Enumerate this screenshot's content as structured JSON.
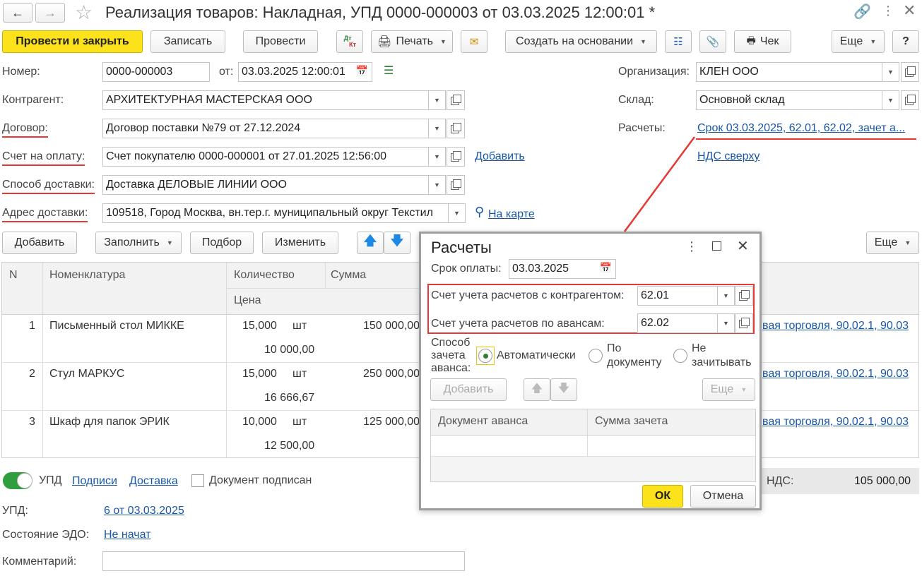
{
  "window": {
    "title": "Реализация товаров: Накладная, УПД 0000-000003 от 03.03.2025 12:00:01 *"
  },
  "toolbar": {
    "post_close": "Провести и закрыть",
    "save": "Записать",
    "post": "Провести",
    "dtkt_top": "Дт",
    "dtkt_bottom": "Кт",
    "print": "Печать",
    "create_based": "Создать на основании",
    "receipt": "Чек",
    "more": "Еще",
    "help": "?"
  },
  "form": {
    "number_label": "Номер:",
    "number_value": "0000-000003",
    "date_label": "от:",
    "date_value": "03.03.2025 12:00:01",
    "org_label": "Организация:",
    "org_value": "КЛЕН ООО",
    "counterparty_label": "Контрагент:",
    "counterparty_value": "АРХИТЕКТУРНАЯ МАСТЕРСКАЯ ООО",
    "warehouse_label": "Склад:",
    "warehouse_value": "Основной склад",
    "contract_label": "Договор:",
    "contract_value": "Договор поставки №79 от 27.12.2024",
    "settlements_label": "Расчеты:",
    "settlements_link": "Срок 03.03.2025, 62.01, 62.02, зачет а...",
    "invoice_label": "Счет на оплату:",
    "invoice_value": "Счет покупателю 0000-000001 от 27.01.2025 12:56:00",
    "invoice_add": "Добавить",
    "vat_link": "НДС сверху",
    "delivery_method_label": "Способ доставки:",
    "delivery_method_value": "Доставка ДЕЛОВЫЕ ЛИНИИ ООО",
    "delivery_address_label": "Адрес доставки:",
    "delivery_address_value": "109518, Город Москва, вн.тер.г. муниципальный округ Текстил",
    "map_link": "На карте"
  },
  "table_toolbar": {
    "add": "Добавить",
    "fill": "Заполнить",
    "pick": "Подбор",
    "change": "Изменить",
    "more": "Еще"
  },
  "table": {
    "columns": {
      "n": "N",
      "item": "Номенклатура",
      "qty": "Количество",
      "price": "Цена",
      "sum": "Сумма"
    },
    "rows": [
      {
        "n": "1",
        "item": "Письменный стол МИККЕ",
        "qty": "15,000",
        "unit": "шт",
        "price": "10 000,00",
        "sum": "150 000,00",
        "accounts": "вая торговля, 90.02.1, 90.03"
      },
      {
        "n": "2",
        "item": "Стул МАРКУС",
        "qty": "15,000",
        "unit": "шт",
        "price": "16 666,67",
        "sum": "250 000,00",
        "accounts": "вая торговля, 90.02.1, 90.03"
      },
      {
        "n": "3",
        "item": "Шкаф для папок ЭРИК",
        "qty": "10,000",
        "unit": "шт",
        "price": "12 500,00",
        "sum": "125 000,00",
        "accounts": "вая торговля, 90.02.1, 90.03"
      }
    ]
  },
  "bottom": {
    "upd_toggle": "УПД",
    "signatures": "Подписи",
    "delivery": "Доставка",
    "doc_signed": "Документ подписан",
    "vat_label": "НДС:",
    "vat_value": "105 000,00",
    "upd_label": "УПД:",
    "upd_value": "6 от 03.03.2025",
    "edo_label": "Состояние ЭДО:",
    "edo_value": "Не начат",
    "comment_label": "Комментарий:",
    "comment_value": ""
  },
  "dialog": {
    "title": "Расчеты",
    "due_label": "Срок оплаты:",
    "due_value": "03.03.2025",
    "acc_counterparty_label": "Счет учета расчетов с контрагентом:",
    "acc_counterparty_value": "62.01",
    "acc_advance_label": "Счет учета расчетов по авансам:",
    "acc_advance_value": "62.02",
    "offset_label_1": "Способ",
    "offset_label_2": "зачета",
    "offset_label_3": "аванса:",
    "opt_auto": "Автоматически",
    "opt_doc_1": "По",
    "opt_doc_2": "документу",
    "opt_none_1": "Не",
    "opt_none_2": "зачитывать",
    "add": "Добавить",
    "more": "Еще",
    "col_doc": "Документ аванса",
    "col_sum": "Сумма зачета",
    "ok": "ОК",
    "cancel": "Отмена"
  },
  "colors": {
    "accent_yellow": "#fce21b",
    "link_blue": "#1a56a6",
    "highlight_red": "#e53935",
    "toggle_green": "#2e9e3e"
  }
}
